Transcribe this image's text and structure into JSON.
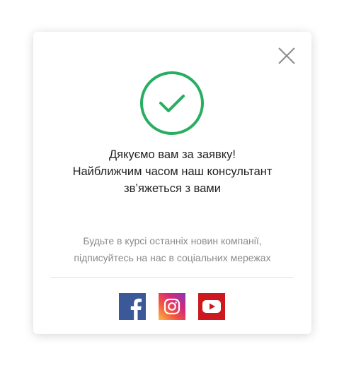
{
  "modal": {
    "close_icon": "close-icon",
    "success_icon": "check-circle-icon",
    "success_color": "#27ae60",
    "message_lines": [
      "Дякуємо вам за заявку!",
      "Найближчим часом наш консультант",
      "зв’яжеться з вами"
    ],
    "subtext_lines": [
      "Будьте в курсі останніх новин компанії,",
      "підписуйтесь на нас в соціальних мережах"
    ],
    "socials": [
      {
        "name": "facebook",
        "icon": "facebook-icon",
        "color": "#3b5998"
      },
      {
        "name": "instagram",
        "icon": "instagram-icon",
        "color": "#e1306c"
      },
      {
        "name": "youtube",
        "icon": "youtube-icon",
        "color": "#cc181e"
      }
    ]
  }
}
